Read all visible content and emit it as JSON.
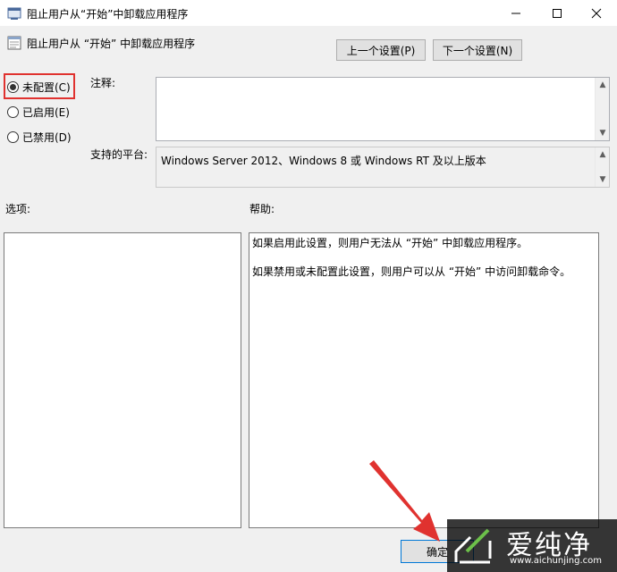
{
  "window": {
    "title": "阻止用户从“开始”中卸载应用程序"
  },
  "header": {
    "title": "阻止用户从 “开始” 中卸载应用程序",
    "prev_label": "上一个设置(P)",
    "next_label": "下一个设置(N)"
  },
  "state": {
    "options": [
      {
        "label": "未配置(C)",
        "selected": true
      },
      {
        "label": "已启用(E)",
        "selected": false
      },
      {
        "label": "已禁用(D)",
        "selected": false
      }
    ]
  },
  "comment": {
    "label": "注释:",
    "value": ""
  },
  "platform": {
    "label": "支持的平台:",
    "value": "Windows Server 2012、Windows 8 或 Windows RT 及以上版本"
  },
  "options_panel": {
    "label": "选项:"
  },
  "help_panel": {
    "label": "帮助:",
    "lines": [
      "如果启用此设置，则用户无法从 “开始” 中卸载应用程序。",
      "如果禁用或未配置此设置，则用户可以从 “开始” 中访问卸载命令。"
    ]
  },
  "footer": {
    "ok_label": "确定"
  },
  "watermark": {
    "name": "爱纯净",
    "url": "www.aichunjing.com"
  },
  "colors": {
    "highlight": "#e0322f",
    "arrow": "#e0322f"
  }
}
